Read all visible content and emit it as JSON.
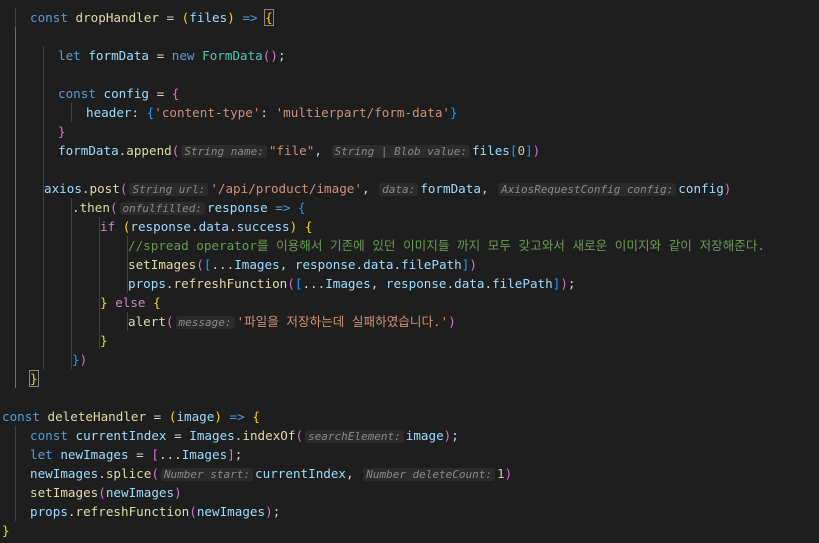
{
  "colors": {
    "background": "#1e1e1e",
    "keyword": "#569cd6",
    "control_keyword": "#c586c0",
    "variable": "#9cdcfe",
    "function": "#dcdcaa",
    "class": "#4ec9b0",
    "string": "#ce9178",
    "number": "#b5cea8",
    "comment": "#6a9955",
    "bracket_level1": "#ffd700",
    "bracket_level2": "#da70d6",
    "bracket_level3": "#179fff"
  },
  "code_lines": [
    {
      "indent": 1,
      "tokens": [
        [
          "kw",
          "const"
        ],
        [
          "pun",
          " "
        ],
        [
          "fn",
          "dropHandler"
        ],
        [
          "pun",
          " = "
        ],
        [
          "b1",
          "("
        ],
        [
          "var",
          "files"
        ],
        [
          "b1",
          ")"
        ],
        [
          "pun",
          " "
        ],
        [
          "kw",
          "=>"
        ],
        [
          "pun",
          " "
        ],
        [
          "b1 hl",
          "{"
        ]
      ]
    },
    {
      "indent": 1,
      "tokens": []
    },
    {
      "indent": 2,
      "tokens": [
        [
          "kw",
          "let"
        ],
        [
          "pun",
          " "
        ],
        [
          "var",
          "formData"
        ],
        [
          "pun",
          " = "
        ],
        [
          "kw",
          "new"
        ],
        [
          "pun",
          " "
        ],
        [
          "cls",
          "FormData"
        ],
        [
          "b2",
          "()"
        ],
        [
          "pun",
          ";"
        ]
      ]
    },
    {
      "indent": 2,
      "tokens": []
    },
    {
      "indent": 2,
      "tokens": [
        [
          "kw",
          "const"
        ],
        [
          "pun",
          " "
        ],
        [
          "var",
          "config"
        ],
        [
          "pun",
          " = "
        ],
        [
          "b2",
          "{"
        ]
      ]
    },
    {
      "indent": 3,
      "tokens": [
        [
          "var",
          "header"
        ],
        [
          "pun",
          ": "
        ],
        [
          "b3",
          "{"
        ],
        [
          "str",
          "'content-type'"
        ],
        [
          "pun",
          ": "
        ],
        [
          "str",
          "'multierpart/form-data'"
        ],
        [
          "b3",
          "}"
        ]
      ]
    },
    {
      "indent": 2,
      "tokens": [
        [
          "b2",
          "}"
        ]
      ]
    },
    {
      "indent": 2,
      "tokens": [
        [
          "var",
          "formData"
        ],
        [
          "pun",
          "."
        ],
        [
          "fn",
          "append"
        ],
        [
          "b2",
          "("
        ],
        [
          "hint",
          "String name:"
        ],
        [
          "str",
          "\"file\""
        ],
        [
          "pun",
          ", "
        ],
        [
          "hint",
          "String | Blob value:"
        ],
        [
          "var",
          "files"
        ],
        [
          "b3",
          "["
        ],
        [
          "num",
          "0"
        ],
        [
          "b3",
          "]"
        ],
        [
          "b2",
          ")"
        ]
      ]
    },
    {
      "indent": 2,
      "tokens": []
    },
    {
      "indent": 2,
      "tokens": [
        [
          "var",
          "axios"
        ],
        [
          "pun",
          "."
        ],
        [
          "fn",
          "post"
        ],
        [
          "b2",
          "("
        ],
        [
          "hint",
          "String url:"
        ],
        [
          "str",
          "'/api/product/image'"
        ],
        [
          "pun",
          ", "
        ],
        [
          "hint",
          "data:"
        ],
        [
          "var",
          "formData"
        ],
        [
          "pun",
          ", "
        ],
        [
          "hint",
          "AxiosRequestConfig config:"
        ],
        [
          "var",
          "config"
        ],
        [
          "b2",
          ")"
        ]
      ]
    },
    {
      "indent": 3,
      "tokens": [
        [
          "pun",
          "."
        ],
        [
          "fn",
          "then"
        ],
        [
          "b2",
          "("
        ],
        [
          "hint",
          "onfulfilled:"
        ],
        [
          "var",
          "response"
        ],
        [
          "pun",
          " "
        ],
        [
          "kw",
          "=>"
        ],
        [
          "pun",
          " "
        ],
        [
          "b3",
          "{"
        ]
      ]
    },
    {
      "indent": 4,
      "tokens": [
        [
          "kw2",
          "if"
        ],
        [
          "pun",
          " "
        ],
        [
          "b1",
          "("
        ],
        [
          "var",
          "response"
        ],
        [
          "pun",
          "."
        ],
        [
          "var",
          "data"
        ],
        [
          "pun",
          "."
        ],
        [
          "var",
          "success"
        ],
        [
          "b1",
          ")"
        ],
        [
          "pun",
          " "
        ],
        [
          "b1",
          "{"
        ]
      ]
    },
    {
      "indent": 5,
      "tokens": [
        [
          "cmt",
          "//spread operator를 이용해서 기존에 있던 이미지들 까지 모두 갖고와서 새로운 이미지와 같이 저장해준다."
        ]
      ]
    },
    {
      "indent": 5,
      "tokens": [
        [
          "fn",
          "setImages"
        ],
        [
          "b2",
          "("
        ],
        [
          "b3",
          "["
        ],
        [
          "pun",
          "..."
        ],
        [
          "var",
          "Images"
        ],
        [
          "pun",
          ", "
        ],
        [
          "var",
          "response"
        ],
        [
          "pun",
          "."
        ],
        [
          "var",
          "data"
        ],
        [
          "pun",
          "."
        ],
        [
          "var",
          "filePath"
        ],
        [
          "b3",
          "]"
        ],
        [
          "b2",
          ")"
        ]
      ]
    },
    {
      "indent": 5,
      "tokens": [
        [
          "var",
          "props"
        ],
        [
          "pun",
          "."
        ],
        [
          "fn",
          "refreshFunction"
        ],
        [
          "b2",
          "("
        ],
        [
          "b3",
          "["
        ],
        [
          "pun",
          "..."
        ],
        [
          "var",
          "Images"
        ],
        [
          "pun",
          ", "
        ],
        [
          "var",
          "response"
        ],
        [
          "pun",
          "."
        ],
        [
          "var",
          "data"
        ],
        [
          "pun",
          "."
        ],
        [
          "var",
          "filePath"
        ],
        [
          "b3",
          "]"
        ],
        [
          "b2",
          ")"
        ],
        [
          "pun",
          ";"
        ]
      ]
    },
    {
      "indent": 4,
      "tokens": [
        [
          "b1",
          "}"
        ],
        [
          "pun",
          " "
        ],
        [
          "kw2",
          "else"
        ],
        [
          "pun",
          " "
        ],
        [
          "b1",
          "{"
        ]
      ]
    },
    {
      "indent": 5,
      "tokens": [
        [
          "fn",
          "alert"
        ],
        [
          "b2",
          "("
        ],
        [
          "hint",
          "message:"
        ],
        [
          "str",
          "'파일을 저장하는데 실패하였습니다.'"
        ],
        [
          "b2",
          ")"
        ]
      ]
    },
    {
      "indent": 4,
      "tokens": [
        [
          "b1",
          "}"
        ]
      ]
    },
    {
      "indent": 3,
      "tokens": [
        [
          "b3",
          "}"
        ],
        [
          "b2",
          ")"
        ]
      ]
    },
    {
      "indent": 1,
      "tokens": [
        [
          "b1 hl",
          "}"
        ]
      ]
    },
    {
      "indent": 0,
      "tokens": []
    },
    {
      "indent": 0,
      "tokens": [
        [
          "kw",
          "const"
        ],
        [
          "pun",
          " "
        ],
        [
          "fn",
          "deleteHandler"
        ],
        [
          "pun",
          " = "
        ],
        [
          "b1",
          "("
        ],
        [
          "var",
          "image"
        ],
        [
          "b1",
          ")"
        ],
        [
          "pun",
          " "
        ],
        [
          "kw",
          "=>"
        ],
        [
          "pun",
          " "
        ],
        [
          "b1",
          "{"
        ]
      ]
    },
    {
      "indent": 1,
      "tokens": [
        [
          "kw",
          "const"
        ],
        [
          "pun",
          " "
        ],
        [
          "var",
          "currentIndex"
        ],
        [
          "pun",
          " = "
        ],
        [
          "var",
          "Images"
        ],
        [
          "pun",
          "."
        ],
        [
          "fn",
          "indexOf"
        ],
        [
          "b2",
          "("
        ],
        [
          "hint",
          "searchElement:"
        ],
        [
          "var",
          "image"
        ],
        [
          "b2",
          ")"
        ],
        [
          "pun",
          ";"
        ]
      ]
    },
    {
      "indent": 1,
      "tokens": [
        [
          "kw",
          "let"
        ],
        [
          "pun",
          " "
        ],
        [
          "var",
          "newImages"
        ],
        [
          "pun",
          " = "
        ],
        [
          "b2",
          "["
        ],
        [
          "pun",
          "..."
        ],
        [
          "var",
          "Images"
        ],
        [
          "b2",
          "]"
        ],
        [
          "pun",
          ";"
        ]
      ]
    },
    {
      "indent": 1,
      "tokens": [
        [
          "var",
          "newImages"
        ],
        [
          "pun",
          "."
        ],
        [
          "fn",
          "splice"
        ],
        [
          "b2",
          "("
        ],
        [
          "hint",
          "Number start:"
        ],
        [
          "var",
          "currentIndex"
        ],
        [
          "pun",
          ", "
        ],
        [
          "hint",
          "Number deleteCount:"
        ],
        [
          "num",
          "1"
        ],
        [
          "b2",
          ")"
        ]
      ]
    },
    {
      "indent": 1,
      "tokens": [
        [
          "fn",
          "setImages"
        ],
        [
          "b2",
          "("
        ],
        [
          "var",
          "newImages"
        ],
        [
          "b2",
          ")"
        ]
      ]
    },
    {
      "indent": 1,
      "tokens": [
        [
          "var",
          "props"
        ],
        [
          "pun",
          "."
        ],
        [
          "fn",
          "refreshFunction"
        ],
        [
          "b2",
          "("
        ],
        [
          "var",
          "newImages"
        ],
        [
          "b2",
          ")"
        ],
        [
          "pun",
          ";"
        ]
      ]
    },
    {
      "indent": 0,
      "tokens": [
        [
          "b1",
          "}"
        ]
      ]
    }
  ]
}
